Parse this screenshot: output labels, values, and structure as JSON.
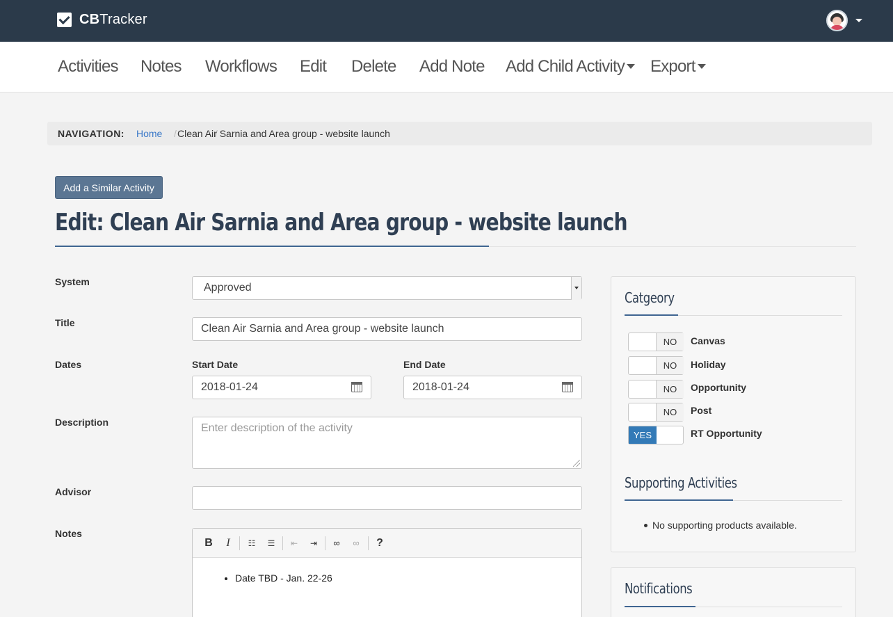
{
  "brand": {
    "bold": "CB",
    "rest": "Tracker"
  },
  "nav": {
    "items": [
      "Activities",
      "Notes",
      "Workflows",
      "Edit",
      "Delete",
      "Add Note",
      "Add Child Activity",
      "Export"
    ]
  },
  "breadcrumb": {
    "label": "NAVIGATION:",
    "separator": "/",
    "home": "Home",
    "current": "Clean Air Sarnia and Area group - website launch"
  },
  "actions": {
    "similar": "Add a Similar Activity"
  },
  "page": {
    "title": "Edit: Clean Air Sarnia and Area group - website launch"
  },
  "form": {
    "system_label": "System",
    "system_value": "Approved",
    "title_label": "Title",
    "title_value": "Clean Air Sarnia and Area group - website launch",
    "dates_label": "Dates",
    "start_label": "Start Date",
    "start_value": "2018-01-24",
    "end_label": "End Date",
    "end_value": "2018-01-24",
    "description_label": "Description",
    "description_placeholder": "Enter description of the activity",
    "advisor_label": "Advisor",
    "advisor_value": "",
    "notes_label": "Notes",
    "notes_items": [
      "Date TBD - Jan. 22-26"
    ]
  },
  "editor_toolbar": {
    "bold": "B",
    "italic": "I",
    "help": "?"
  },
  "category": {
    "title": "Catgeory",
    "items": [
      {
        "label": "Canvas",
        "state": "NO"
      },
      {
        "label": "Holiday",
        "state": "NO"
      },
      {
        "label": "Opportunity",
        "state": "NO"
      },
      {
        "label": "Post",
        "state": "NO"
      },
      {
        "label": "RT Opportunity",
        "state": "YES"
      }
    ]
  },
  "supporting": {
    "title": "Supporting Activities",
    "empty_text": "No supporting products available."
  },
  "notifications": {
    "title": "Notifications"
  },
  "colors": {
    "topbar": "#2b3a4a",
    "accent": "#3f6591",
    "link": "#3a78c8",
    "yes": "#337ab7"
  }
}
